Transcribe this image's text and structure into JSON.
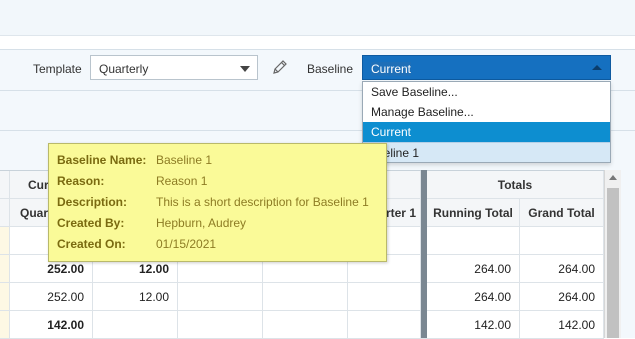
{
  "toolbar": {
    "template_label": "Template",
    "template_value": "Quarterly",
    "baseline_label": "Baseline",
    "baseline_value": "Current"
  },
  "baseline_menu": {
    "options": [
      {
        "label": "Save Baseline...",
        "state": "normal"
      },
      {
        "label": "Manage Baseline...",
        "state": "normal"
      },
      {
        "label": "Current",
        "state": "selected"
      },
      {
        "label": "aseline 1",
        "state": "hover"
      }
    ]
  },
  "tooltip": {
    "rows": [
      {
        "key": "Baseline Name:",
        "value": "Baseline 1"
      },
      {
        "key": "Reason:",
        "value": "Reason 1"
      },
      {
        "key": "Description:",
        "value": "This is a short description for Baseline 1"
      },
      {
        "key": "Created By:",
        "value": "Hepburn, Audrey"
      },
      {
        "key": "Created On:",
        "value": "01/15/2021"
      }
    ]
  },
  "grid": {
    "group_header_left": "Cur",
    "group_header_totals": "Totals",
    "columns": [
      "Quar",
      "",
      "",
      "",
      "rter 1",
      "Running Total",
      "Grand Total"
    ],
    "rows": [
      [
        "",
        "",
        "",
        "",
        "",
        "",
        ""
      ],
      [
        "252.00",
        "12.00",
        "",
        "",
        "",
        "264.00",
        "264.00"
      ],
      [
        "252.00",
        "12.00",
        "",
        "",
        "",
        "264.00",
        "264.00"
      ],
      [
        "142.00",
        "",
        "",
        "",
        "",
        "142.00",
        "142.00"
      ]
    ]
  },
  "colors": {
    "accent": "#1570c0",
    "selected_option": "#0d8ed0",
    "tooltip_bg": "#fafa98"
  },
  "icons": {
    "edit": "pencil-icon",
    "dropdown_caret": "chevron-down-icon"
  }
}
